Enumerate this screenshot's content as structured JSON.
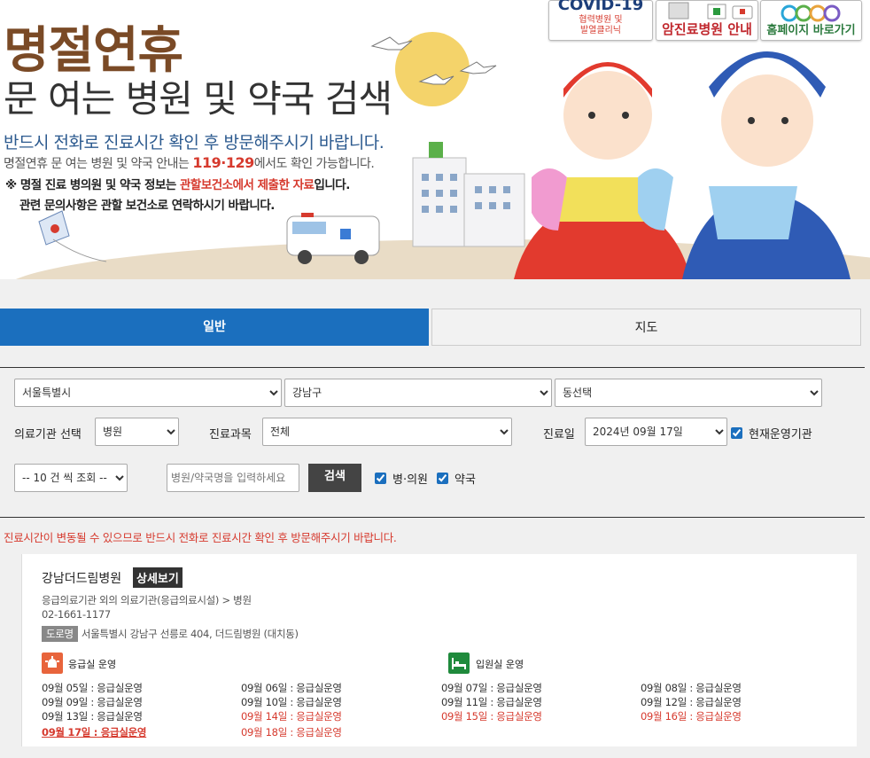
{
  "banner": {
    "title_1": "명절연휴",
    "title_2": "문 여는 병원 및 약국 검색",
    "line_1": "반드시 전화로 진료시간 확인 후 방문해주시기 바랍니다.",
    "line_2_prefix": "명절연휴 문 여는 병원 및 약국 안내는 ",
    "line_2_highlight": "119·129",
    "line_2_suffix": "에서도 확인 가능합니다.",
    "line_3_prefix": "※ 명절 진료 병의원 및 약국 정보는 ",
    "line_3_highlight": "관할보건소에서 제출한 자료",
    "line_3_suffix": "입니다.",
    "line_4": "관련 문의사항은 관할 보건소로 연락하시기 바랍니다."
  },
  "quick_links": {
    "covid_title": "COVID-19",
    "covid_sub_1": "협력병원 및",
    "covid_sub_2": "발열클리닉",
    "cancer_label": "암진료병원 안내",
    "home_label": "홈페이지 바로가기"
  },
  "tabs": [
    {
      "label": "일반",
      "active": true
    },
    {
      "label": "지도",
      "active": false
    }
  ],
  "filters": {
    "city": "서울특별시",
    "district": "강남구",
    "dong": "동선택",
    "facility_label": "의료기관 선택",
    "facility_value": "병원",
    "dept_label": "진료과목",
    "dept_value": "전체",
    "date_label": "진료일",
    "date_value": "2024년 09월 17일",
    "currently_open_label": "현재운영기관",
    "currently_open_checked": true,
    "page_size": "-- 10 건 씩 조회 --",
    "search_placeholder": "병원/약국명을 입력하세요",
    "search_button": "검색",
    "hospital_check_label": "병·의원",
    "hospital_checked": true,
    "pharmacy_check_label": "약국",
    "pharmacy_checked": true
  },
  "notice": "진료시간이 변동될 수 있으므로 반드시 전화로 진료시간 확인 후 방문해주시기 바랍니다.",
  "result": {
    "name": "강남더드림병원",
    "detail_button": "상세보기",
    "category": "응급의료기관 외의 의료기관(응급의료시설) > 병원",
    "phone": "02-1661-1177",
    "road_badge": "도로명",
    "address": "서울특별시 강남구 선릉로 404, 더드림병원 (대치동)",
    "service_er": "응급실 운영",
    "service_ward": "입원실 운영",
    "schedule": [
      {
        "text": "09월 05일 : 응급실운영",
        "style": "normal"
      },
      {
        "text": "09월 06일 : 응급실운영",
        "style": "normal"
      },
      {
        "text": "09월 07일 : 응급실운영",
        "style": "normal"
      },
      {
        "text": "09월 08일 : 응급실운영",
        "style": "normal"
      },
      {
        "text": "09월 09일 : 응급실운영",
        "style": "normal"
      },
      {
        "text": "09월 10일 : 응급실운영",
        "style": "normal"
      },
      {
        "text": "09월 11일 : 응급실운영",
        "style": "normal"
      },
      {
        "text": "09월 12일 : 응급실운영",
        "style": "normal"
      },
      {
        "text": "09월 13일 : 응급실운영",
        "style": "normal"
      },
      {
        "text": "09월 14일 : 응급실운영",
        "style": "red"
      },
      {
        "text": "09월 15일 : 응급실운영",
        "style": "red"
      },
      {
        "text": "09월 16일 : 응급실운영",
        "style": "red"
      },
      {
        "text": "09월 17일 : 응급실운영",
        "style": "today"
      },
      {
        "text": "09월 18일 : 응급실운영",
        "style": "red"
      }
    ]
  },
  "colors": {
    "primary": "#1b6fbe",
    "alert_red": "#d63a2e",
    "title_brown": "#7a4a26",
    "er_orange": "#e8643c",
    "ward_green": "#1f8a3c"
  }
}
